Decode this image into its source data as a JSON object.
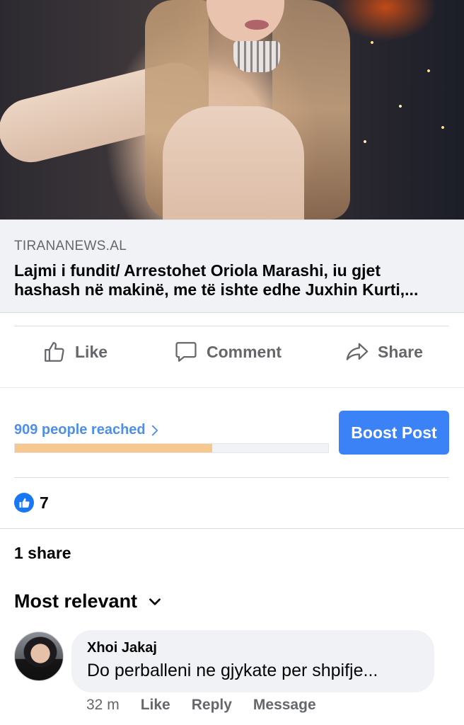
{
  "link_preview": {
    "domain": "TIRANANEWS.AL",
    "title": "Lajmi i fundit/ Arrestohet Oriola Marashi, iu gjet hashash në makinë, me të ishte edhe Juxhin Kurti,..."
  },
  "actions": {
    "like": "Like",
    "comment": "Comment",
    "share": "Share"
  },
  "insights": {
    "reach_label": "909 people reached",
    "reach_progress": 0.63,
    "boost_label": "Boost Post"
  },
  "reactions": {
    "icon": "thumbs-up-icon",
    "count": "7"
  },
  "shares_label": "1 share",
  "sort_label": "Most relevant",
  "comment": {
    "author": "Xhoi Jakaj",
    "text": "Do perballeni ne gjykate per shpifje...",
    "time": "32 m",
    "like_label": "Like",
    "reply_label": "Reply",
    "message_label": "Message"
  },
  "colors": {
    "accent": "#1877f2",
    "boost": "#3b82f6",
    "reach_text": "#4d8fe9",
    "reach_fill": "#f6c88d"
  }
}
